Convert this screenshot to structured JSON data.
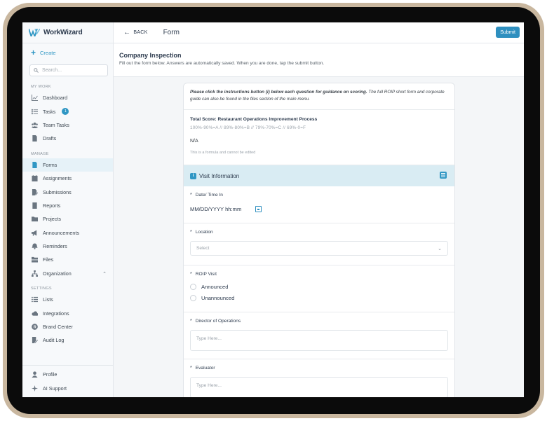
{
  "brand": {
    "name": "WorkWizard",
    "accent": "#3097c4"
  },
  "sidebar": {
    "create_label": "Create",
    "search_placeholder": "Search...",
    "sections": {
      "my_work": "MY WORK",
      "manage": "MANAGE",
      "settings": "SETTINGS"
    },
    "my_work_items": [
      {
        "label": "Dashboard",
        "icon": "chart-icon"
      },
      {
        "label": "Tasks",
        "icon": "checklist-icon",
        "badge": "1"
      },
      {
        "label": "Team Tasks",
        "icon": "team-icon"
      },
      {
        "label": "Drafts",
        "icon": "document-icon"
      }
    ],
    "manage_items": [
      {
        "label": "Forms",
        "icon": "form-icon",
        "active": true
      },
      {
        "label": "Assignments",
        "icon": "calendar-icon"
      },
      {
        "label": "Submissions",
        "icon": "submission-icon"
      },
      {
        "label": "Reports",
        "icon": "report-icon"
      },
      {
        "label": "Projects",
        "icon": "folder-icon"
      },
      {
        "label": "Announcements",
        "icon": "megaphone-icon"
      },
      {
        "label": "Reminders",
        "icon": "bell-icon"
      },
      {
        "label": "Files",
        "icon": "files-icon"
      },
      {
        "label": "Organization",
        "icon": "org-icon"
      }
    ],
    "settings_items": [
      {
        "label": "Lists",
        "icon": "list-icon"
      },
      {
        "label": "Integrations",
        "icon": "cloud-icon"
      },
      {
        "label": "Brand Center",
        "icon": "brand-icon"
      },
      {
        "label": "Audit Log",
        "icon": "audit-icon"
      }
    ],
    "bottom_items": [
      {
        "label": "Profile",
        "icon": "user-icon"
      },
      {
        "label": "AI Support",
        "icon": "sparkle-icon"
      }
    ]
  },
  "topbar": {
    "back_label": "BACK",
    "title": "Form",
    "submit_label": "Submit"
  },
  "page": {
    "title": "Company Inspection",
    "subtitle": "Fill out the form below. Answers are automatically saved. When you are done, tap the submit button."
  },
  "form": {
    "instructions_bold": "Please click the instructions button (i) below each question for guidance on scoring.",
    "instructions_rest": " The full ROIP short form and corporate guide can also be found in the files section of the main menu.",
    "score_label": "Total Score: Restaurant Operations Improvement Process",
    "score_scale": "100%-90%=A // 89%-80%=B // 79%-70%=C // 69%-0=F",
    "score_value": "N/A",
    "score_note": "This is a formula and cannot be edited",
    "section_title": "Visit Information",
    "fields": {
      "datetime": {
        "label": "Date/ Time In",
        "value": "MM/DD/YYYY hh:mm"
      },
      "location": {
        "label": "Location",
        "placeholder": "Select"
      },
      "roip": {
        "label": "ROIP Visit",
        "options": [
          "Announced",
          "Unannounced"
        ]
      },
      "director": {
        "label": "Director of Operations",
        "placeholder": "Type Here..."
      },
      "evaluator": {
        "label": "Evaluator",
        "placeholder": "Type Here..."
      }
    },
    "required_mark": "*"
  }
}
